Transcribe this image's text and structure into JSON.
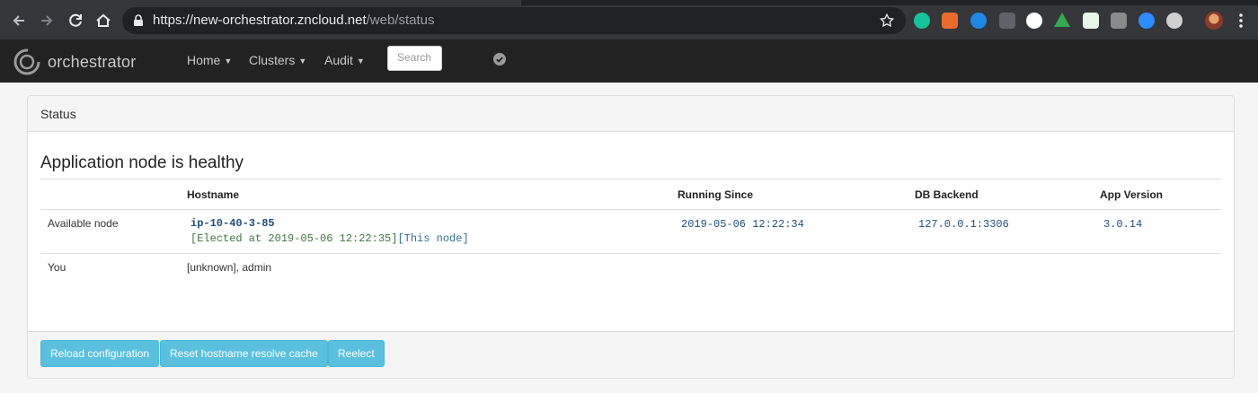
{
  "browser": {
    "url_host": "https://new-orchestrator.zncloud.net",
    "url_path": "/web/status"
  },
  "navbar": {
    "brand": "orchestrator",
    "menus": [
      {
        "label": "Home"
      },
      {
        "label": "Clusters"
      },
      {
        "label": "Audit"
      }
    ],
    "search_placeholder": "Search"
  },
  "panel": {
    "heading": "Status",
    "title": "Application node is healthy",
    "columns": [
      "",
      "Hostname",
      "Running Since",
      "DB Backend",
      "App Version"
    ],
    "rows": {
      "available": {
        "label": "Available node",
        "hostname": "ip-10-40-3-85",
        "elected": "[Elected at 2019-05-06 12:22:35]",
        "this_node": "[This node]",
        "running_since": "2019-05-06 12:22:34",
        "db_backend": "127.0.0.1:3306",
        "app_version": "3.0.14"
      },
      "you": {
        "label": "You",
        "value": "[unknown], admin"
      }
    },
    "buttons": {
      "reload": "Reload configuration",
      "reset_cache": "Reset hostname resolve cache",
      "reelect": "Reelect"
    }
  },
  "colors": {
    "navbar_bg": "#222222",
    "button_info": "#5bc0de",
    "code_blue": "#1f4e79",
    "elected_green": "#3c763d"
  }
}
